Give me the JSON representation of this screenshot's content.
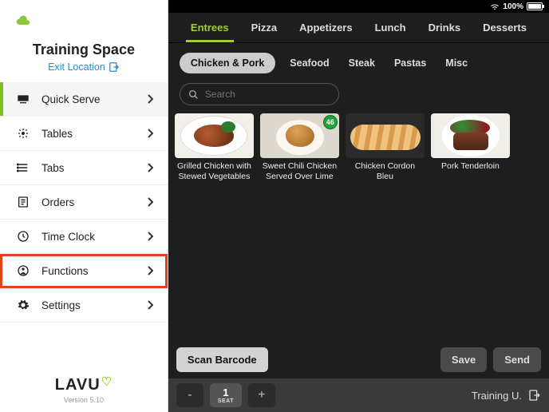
{
  "status": {
    "battery_pct": "100%"
  },
  "sidebar": {
    "title": "Training Space",
    "exit_label": "Exit Location",
    "items": [
      {
        "label": "Quick Serve"
      },
      {
        "label": "Tables"
      },
      {
        "label": "Tabs"
      },
      {
        "label": "Orders"
      },
      {
        "label": "Time Clock"
      },
      {
        "label": "Functions"
      },
      {
        "label": "Settings"
      }
    ],
    "brand": "LAVU",
    "version": "Version 5.10"
  },
  "top_tabs": [
    {
      "label": "Entrees"
    },
    {
      "label": "Pizza"
    },
    {
      "label": "Appetizers"
    },
    {
      "label": "Lunch"
    },
    {
      "label": "Drinks"
    },
    {
      "label": "Desserts"
    }
  ],
  "sub_tabs": [
    {
      "label": "Chicken & Pork"
    },
    {
      "label": "Seafood"
    },
    {
      "label": "Steak"
    },
    {
      "label": "Pastas"
    },
    {
      "label": "Misc"
    }
  ],
  "search": {
    "placeholder": "Search"
  },
  "items": [
    {
      "label": "Grilled Chicken with Stewed Vegetables",
      "badge": null
    },
    {
      "label": "Sweet Chili Chicken Served Over Lime",
      "badge": "46"
    },
    {
      "label": "Chicken Cordon Bleu",
      "badge": null
    },
    {
      "label": "Pork Tenderloin",
      "badge": null
    }
  ],
  "actions": {
    "scan": "Scan Barcode",
    "save": "Save",
    "send": "Send"
  },
  "seat": {
    "count": "1",
    "label": "SEAT",
    "user": "Training U."
  }
}
